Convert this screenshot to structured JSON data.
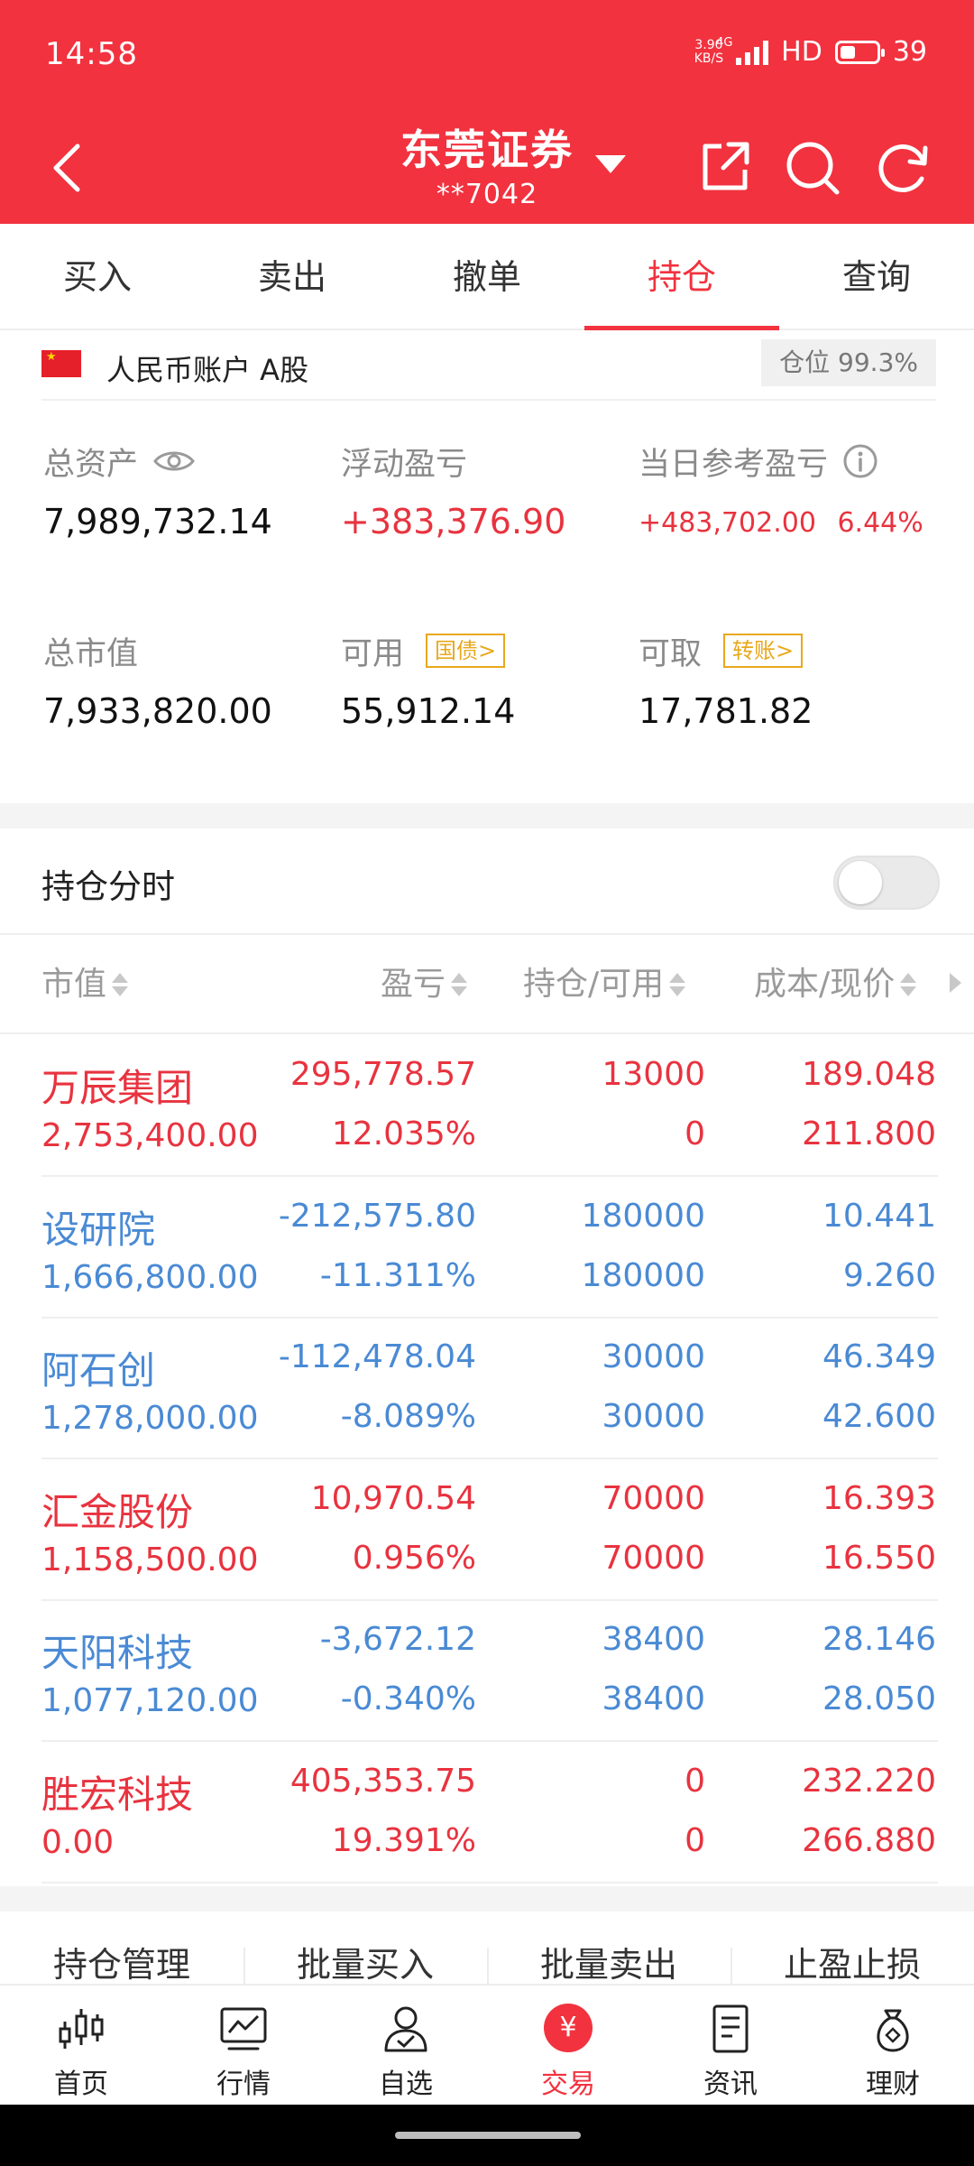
{
  "status": {
    "time": "14:58",
    "net_speed_top": "3.90",
    "net_speed_bottom": "KB/S",
    "network": "4G",
    "hd": "HD",
    "battery": "39"
  },
  "header": {
    "title": "东莞证券",
    "account": "**7042"
  },
  "tabs": [
    "买入",
    "卖出",
    "撤单",
    "持仓",
    "查询"
  ],
  "account": {
    "label": "人民币账户 A股",
    "position": "仓位 99.3%"
  },
  "summary": {
    "total_assets_label": "总资产",
    "total_assets": "7,989,732.14",
    "float_pl_label": "浮动盈亏",
    "float_pl": "+383,376.90",
    "daily_pl_label": "当日参考盈亏",
    "daily_pl": "+483,702.00",
    "daily_pl_pct": "6.44%",
    "market_value_label": "总市值",
    "market_value": "7,933,820.00",
    "available_label": "可用",
    "available_tag": "国债>",
    "available": "55,912.14",
    "withdrawable_label": "可取",
    "withdrawable_tag": "转账>",
    "withdrawable": "17,781.82"
  },
  "holdings": {
    "title": "持仓分时",
    "headers": {
      "market_value": "市值",
      "pl": "盈亏",
      "qty": "持仓/可用",
      "price": "成本/现价"
    },
    "rows": [
      {
        "name": "万辰集团",
        "market_value": "2,753,400.00",
        "pl": "295,778.57",
        "pl_pct": "12.035%",
        "qty": "13000",
        "avail": "0",
        "cost": "189.048",
        "price": "211.800",
        "color": "#e8333f"
      },
      {
        "name": "设研院",
        "market_value": "1,666,800.00",
        "pl": "-212,575.80",
        "pl_pct": "-11.311%",
        "qty": "180000",
        "avail": "180000",
        "cost": "10.441",
        "price": "9.260",
        "color": "#4a8ad4"
      },
      {
        "name": "阿石创",
        "market_value": "1,278,000.00",
        "pl": "-112,478.04",
        "pl_pct": "-8.089%",
        "qty": "30000",
        "avail": "30000",
        "cost": "46.349",
        "price": "42.600",
        "color": "#4a8ad4"
      },
      {
        "name": "汇金股份",
        "market_value": "1,158,500.00",
        "pl": "10,970.54",
        "pl_pct": "0.956%",
        "qty": "70000",
        "avail": "70000",
        "cost": "16.393",
        "price": "16.550",
        "color": "#e8333f"
      },
      {
        "name": "天阳科技",
        "market_value": "1,077,120.00",
        "pl": "-3,672.12",
        "pl_pct": "-0.340%",
        "qty": "38400",
        "avail": "38400",
        "cost": "28.146",
        "price": "28.050",
        "color": "#4a8ad4"
      },
      {
        "name": "胜宏科技",
        "market_value": "0.00",
        "pl": "405,353.75",
        "pl_pct": "19.391%",
        "qty": "0",
        "avail": "0",
        "cost": "232.220",
        "price": "266.880",
        "color": "#e8333f"
      }
    ]
  },
  "actions": [
    "持仓管理",
    "批量买入",
    "批量卖出",
    "止盈止损"
  ],
  "bottom_nav": [
    "首页",
    "行情",
    "自选",
    "交易",
    "资讯",
    "理财"
  ],
  "colors": {
    "brand": "#f2323f",
    "gain": "#e8333f",
    "loss": "#4a8ad4"
  }
}
